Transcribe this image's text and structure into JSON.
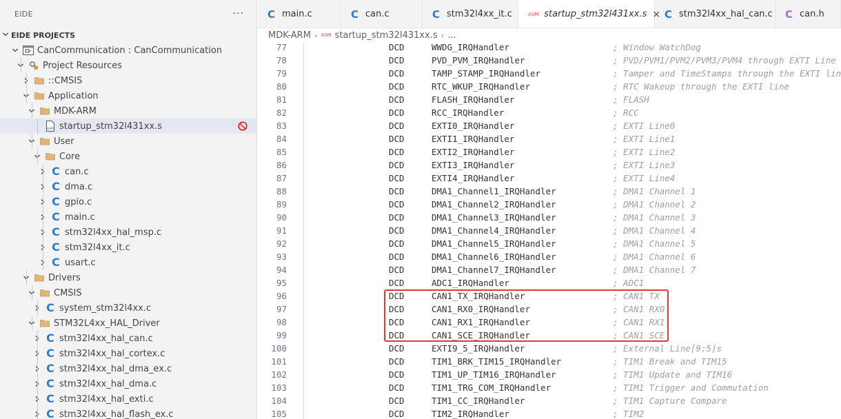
{
  "sidebar": {
    "title": "EIDE",
    "more_label": "···",
    "section_title": "EIDE PROJECTS",
    "tree": [
      {
        "label": "CanCommunication : CanCommunication",
        "icon": "project-icon",
        "depth": 0,
        "expanded": true
      },
      {
        "label": "Project Resources",
        "icon": "resources-icon",
        "depth": 1,
        "expanded": true
      },
      {
        "label": "::CMSIS",
        "icon": "folder-icon",
        "depth": 2,
        "expanded": false
      },
      {
        "label": "Application",
        "icon": "folder-icon",
        "depth": 2,
        "expanded": true
      },
      {
        "label": "MDK-ARM",
        "icon": "folder-icon",
        "depth": 3,
        "expanded": true
      },
      {
        "label": "startup_stm32l431xx.s",
        "icon": "asm-file-icon",
        "depth": 4,
        "leaf": true,
        "selected": true,
        "badge": "excluded-icon"
      },
      {
        "label": "User",
        "icon": "folder-icon",
        "depth": 3,
        "expanded": true
      },
      {
        "label": "Core",
        "icon": "folder-icon",
        "depth": 4,
        "expanded": true
      },
      {
        "label": "can.c",
        "icon": "c-file-icon",
        "depth": 5,
        "expanded": false
      },
      {
        "label": "dma.c",
        "icon": "c-file-icon",
        "depth": 5,
        "expanded": false
      },
      {
        "label": "gpio.c",
        "icon": "c-file-icon",
        "depth": 5,
        "expanded": false
      },
      {
        "label": "main.c",
        "icon": "c-file-icon",
        "depth": 5,
        "expanded": false
      },
      {
        "label": "stm32l4xx_hal_msp.c",
        "icon": "c-file-icon",
        "depth": 5,
        "expanded": false
      },
      {
        "label": "stm32l4xx_it.c",
        "icon": "c-file-icon",
        "depth": 5,
        "expanded": false
      },
      {
        "label": "usart.c",
        "icon": "c-file-icon",
        "depth": 5,
        "expanded": false
      },
      {
        "label": "Drivers",
        "icon": "folder-icon",
        "depth": 2,
        "expanded": true
      },
      {
        "label": "CMSIS",
        "icon": "folder-icon",
        "depth": 3,
        "expanded": true
      },
      {
        "label": "system_stm32l4xx.c",
        "icon": "c-file-icon",
        "depth": 4,
        "expanded": false
      },
      {
        "label": "STM32L4xx_HAL_Driver",
        "icon": "folder-icon",
        "depth": 3,
        "expanded": true
      },
      {
        "label": "stm32l4xx_hal_can.c",
        "icon": "c-file-icon",
        "depth": 4,
        "expanded": false
      },
      {
        "label": "stm32l4xx_hal_cortex.c",
        "icon": "c-file-icon",
        "depth": 4,
        "expanded": false
      },
      {
        "label": "stm32l4xx_hal_dma_ex.c",
        "icon": "c-file-icon",
        "depth": 4,
        "expanded": false
      },
      {
        "label": "stm32l4xx_hal_dma.c",
        "icon": "c-file-icon",
        "depth": 4,
        "expanded": false
      },
      {
        "label": "stm32l4xx_hal_exti.c",
        "icon": "c-file-icon",
        "depth": 4,
        "expanded": false
      },
      {
        "label": "stm32l4xx_hal_flash_ex.c",
        "icon": "c-file-icon",
        "depth": 4,
        "expanded": false
      }
    ]
  },
  "tabs": [
    {
      "label": "main.c",
      "icon": "c-file-icon",
      "active": false
    },
    {
      "label": "can.c",
      "icon": "c-file-icon",
      "active": false
    },
    {
      "label": "stm32l4xx_it.c",
      "icon": "c-file-icon",
      "active": false
    },
    {
      "label": "startup_stm32l431xx.s",
      "icon": "asm-file-icon",
      "active": true,
      "close": "×"
    },
    {
      "label": "stm32l4xx_hal_can.c",
      "icon": "c-file-icon",
      "active": false
    },
    {
      "label": "can.h",
      "icon": "h-file-icon",
      "active": false
    }
  ],
  "breadcrumb": {
    "items": [
      "MDK-ARM",
      "startup_stm32l431xx.s",
      "..."
    ],
    "asm_tag": "ASM"
  },
  "editor": {
    "lines": [
      {
        "n": "77",
        "kw": "DCD",
        "sym": "WWDG_IRQHandler",
        "comment": "; Window WatchDog"
      },
      {
        "n": "78",
        "kw": "DCD",
        "sym": "PVD_PVM_IRQHandler",
        "comment": "; PVD/PVM1/PVM2/PVM3/PVM4 through EXTI Line"
      },
      {
        "n": "79",
        "kw": "DCD",
        "sym": "TAMP_STAMP_IRQHandler",
        "comment": "; Tamper and TimeStamps through the EXTI line"
      },
      {
        "n": "80",
        "kw": "DCD",
        "sym": "RTC_WKUP_IRQHandler",
        "comment": "; RTC Wakeup through the EXTI line"
      },
      {
        "n": "81",
        "kw": "DCD",
        "sym": "FLASH_IRQHandler",
        "comment": "; FLASH"
      },
      {
        "n": "82",
        "kw": "DCD",
        "sym": "RCC_IRQHandler",
        "comment": "; RCC"
      },
      {
        "n": "83",
        "kw": "DCD",
        "sym": "EXTI0_IRQHandler",
        "comment": "; EXTI Line0"
      },
      {
        "n": "84",
        "kw": "DCD",
        "sym": "EXTI1_IRQHandler",
        "comment": "; EXTI Line1"
      },
      {
        "n": "85",
        "kw": "DCD",
        "sym": "EXTI2_IRQHandler",
        "comment": "; EXTI Line2"
      },
      {
        "n": "86",
        "kw": "DCD",
        "sym": "EXTI3_IRQHandler",
        "comment": "; EXTI Line3"
      },
      {
        "n": "87",
        "kw": "DCD",
        "sym": "EXTI4_IRQHandler",
        "comment": "; EXTI Line4"
      },
      {
        "n": "88",
        "kw": "DCD",
        "sym": "DMA1_Channel1_IRQHandler",
        "comment": "; DMA1 Channel 1"
      },
      {
        "n": "89",
        "kw": "DCD",
        "sym": "DMA1_Channel2_IRQHandler",
        "comment": "; DMA1 Channel 2"
      },
      {
        "n": "90",
        "kw": "DCD",
        "sym": "DMA1_Channel3_IRQHandler",
        "comment": "; DMA1 Channel 3"
      },
      {
        "n": "91",
        "kw": "DCD",
        "sym": "DMA1_Channel4_IRQHandler",
        "comment": "; DMA1 Channel 4"
      },
      {
        "n": "92",
        "kw": "DCD",
        "sym": "DMA1_Channel5_IRQHandler",
        "comment": "; DMA1 Channel 5"
      },
      {
        "n": "93",
        "kw": "DCD",
        "sym": "DMA1_Channel6_IRQHandler",
        "comment": "; DMA1 Channel 6"
      },
      {
        "n": "94",
        "kw": "DCD",
        "sym": "DMA1_Channel7_IRQHandler",
        "comment": "; DMA1 Channel 7"
      },
      {
        "n": "95",
        "kw": "DCD",
        "sym": "ADC1_IRQHandler",
        "comment": "; ADC1"
      },
      {
        "n": "96",
        "kw": "DCD",
        "sym": "CAN1_TX_IRQHandler",
        "comment": "; CAN1 TX"
      },
      {
        "n": "97",
        "kw": "DCD",
        "sym": "CAN1_RX0_IRQHandler",
        "comment": "; CAN1 RX0"
      },
      {
        "n": "98",
        "kw": "DCD",
        "sym": "CAN1_RX1_IRQHandler",
        "comment": "; CAN1 RX1"
      },
      {
        "n": "99",
        "kw": "DCD",
        "sym": "CAN1_SCE_IRQHandler",
        "comment": "; CAN1 SCE"
      },
      {
        "n": "100",
        "kw": "DCD",
        "sym": "EXTI9_5_IRQHandler",
        "comment": "; External Line[9:5]s"
      },
      {
        "n": "101",
        "kw": "DCD",
        "sym": "TIM1_BRK_TIM15_IRQHandler",
        "comment": "; TIM1 Break and TIM15"
      },
      {
        "n": "102",
        "kw": "DCD",
        "sym": "TIM1_UP_TIM16_IRQHandler",
        "comment": "; TIM1 Update and TIM16"
      },
      {
        "n": "103",
        "kw": "DCD",
        "sym": "TIM1_TRG_COM_IRQHandler",
        "comment": "; TIM1 Trigger and Commutation"
      },
      {
        "n": "104",
        "kw": "DCD",
        "sym": "TIM1_CC_IRQHandler",
        "comment": "; TIM1 Capture Compare"
      },
      {
        "n": "105",
        "kw": "DCD",
        "sym": "TIM2_IRQHandler",
        "comment": "; TIM2"
      }
    ],
    "highlighted_lines": [
      "96",
      "97",
      "98",
      "99"
    ]
  },
  "colors": {
    "c_icon": "#2d7bc9",
    "h_icon": "#a074c4",
    "asm_icon": "#e05540",
    "folder": "#dcb67a",
    "highlight_box": "#e53935",
    "excluded_badge": "#e51400"
  }
}
